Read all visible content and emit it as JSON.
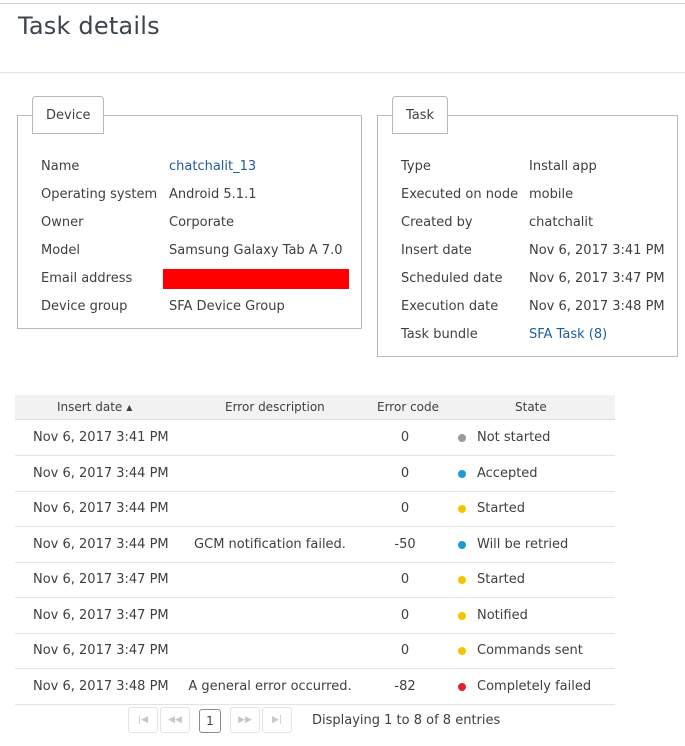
{
  "page": {
    "title": "Task details"
  },
  "device": {
    "tab": "Device",
    "fields": [
      {
        "label": "Name",
        "value": "chatchalit_13"
      },
      {
        "label": "Operating system",
        "value": "Android 5.1.1"
      },
      {
        "label": "Owner",
        "value": "Corporate"
      },
      {
        "label": "Model",
        "value": "Samsung Galaxy Tab A 7.0"
      },
      {
        "label": "Email address",
        "value": ""
      },
      {
        "label": "Device group",
        "value": "SFA Device Group"
      }
    ]
  },
  "task": {
    "tab": "Task",
    "fields": [
      {
        "label": "Type",
        "value": "Install app"
      },
      {
        "label": "Executed on node",
        "value": "mobile"
      },
      {
        "label": "Created by",
        "value": "chatchalit"
      },
      {
        "label": "Insert date",
        "value": "Nov 6, 2017 3:41 PM"
      },
      {
        "label": "Scheduled date",
        "value": "Nov 6, 2017 3:47 PM"
      },
      {
        "label": "Execution date",
        "value": "Nov 6, 2017 3:48 PM"
      },
      {
        "label": "Task bundle",
        "value": "SFA Task (8)"
      }
    ]
  },
  "grid": {
    "columns": [
      "Insert date",
      "Error description",
      "Error code",
      "State"
    ],
    "sort_indicator": "▲",
    "rows": [
      {
        "insert_date": "Nov 6, 2017 3:41 PM",
        "error_description": "",
        "error_code": "0",
        "state": "Not started",
        "state_color": "#9b9b9b"
      },
      {
        "insert_date": "Nov 6, 2017 3:44 PM",
        "error_description": "",
        "error_code": "0",
        "state": "Accepted",
        "state_color": "#1a9bd7"
      },
      {
        "insert_date": "Nov 6, 2017 3:44 PM",
        "error_description": "",
        "error_code": "0",
        "state": "Started",
        "state_color": "#f2c500"
      },
      {
        "insert_date": "Nov 6, 2017 3:44 PM",
        "error_description": "GCM notification failed.",
        "error_code": "-50",
        "state": "Will be retried",
        "state_color": "#1a9bd7"
      },
      {
        "insert_date": "Nov 6, 2017 3:47 PM",
        "error_description": "",
        "error_code": "0",
        "state": "Started",
        "state_color": "#f2c500"
      },
      {
        "insert_date": "Nov 6, 2017 3:47 PM",
        "error_description": "",
        "error_code": "0",
        "state": "Notified",
        "state_color": "#f2c500"
      },
      {
        "insert_date": "Nov 6, 2017 3:47 PM",
        "error_description": "",
        "error_code": "0",
        "state": "Commands sent",
        "state_color": "#f2c500"
      },
      {
        "insert_date": "Nov 6, 2017 3:48 PM",
        "error_description": "A general error occurred.",
        "error_code": "-82",
        "state": "Completely failed",
        "state_color": "#e0242a"
      }
    ]
  },
  "pager": {
    "first": "|◀",
    "prev": "◀◀",
    "current_page": "1",
    "next": "▶▶",
    "last": "▶|",
    "info": "Displaying 1 to 8 of 8 entries"
  }
}
